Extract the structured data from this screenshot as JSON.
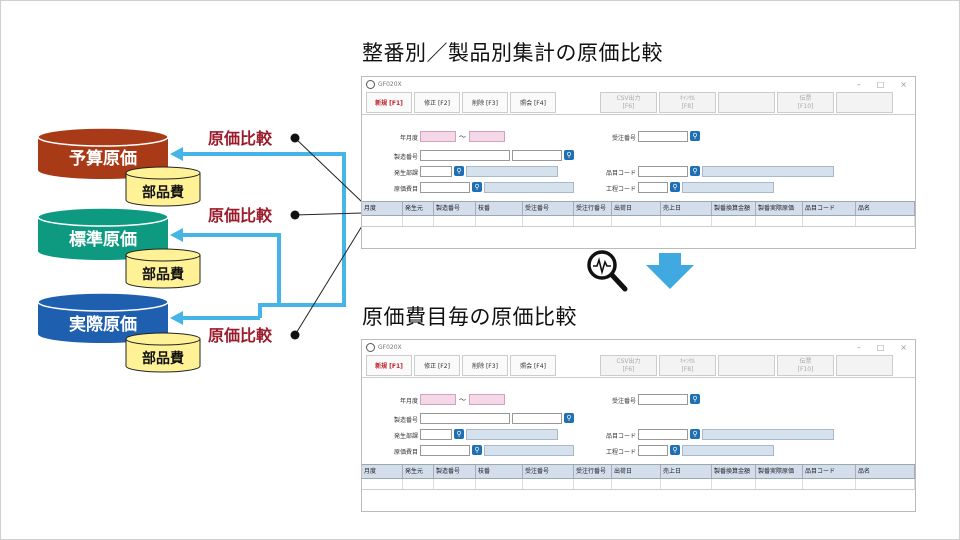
{
  "heading_top": "整番別／製品別集計の原価比較",
  "heading_bottom": "原価費目毎の原価比較",
  "cylinders": [
    {
      "label": "予算原価",
      "sub": "部品費",
      "color": "#a83a17"
    },
    {
      "label": "標準原価",
      "sub": "部品費",
      "color": "#0e9a80"
    },
    {
      "label": "実際原価",
      "sub": "部品費",
      "color": "#1f5faf"
    }
  ],
  "compare_labels": [
    "原価比較",
    "原価比較",
    "原価比較"
  ],
  "sub_color": "#fff296",
  "arrow_color": "#45b4e6",
  "down_arrow_color": "#3fa9e0",
  "icons": {
    "analyze": "magnifier-waveform-icon",
    "down": "down-arrow-icon"
  },
  "window": {
    "title": "GF020X",
    "buttons": [
      "新規 [F1]",
      "修正 [F2]",
      "削除 [F3]",
      "照会 [F4]"
    ],
    "disabled_buttons": [
      {
        "line1": "CSV出力",
        "line2": "[F6]"
      },
      {
        "line1": "ｷｬﾝｾﾙ",
        "line2": "[F8]"
      },
      {
        "line1": "",
        "line2": ""
      },
      {
        "line1": "伝票",
        "line2": "[F10]"
      },
      {
        "line1": "",
        "line2": ""
      }
    ],
    "fields_left": [
      "年月度",
      "製造番号",
      "発生部課",
      "原価費目"
    ],
    "fields_right": [
      "受注番号",
      "品目コード",
      "工程コード"
    ],
    "tilde": "～",
    "search_glyph": "⚲",
    "columns": [
      "月度",
      "発生元",
      "製造番号",
      "枝番",
      "受注番号",
      "受注行番号",
      "出荷日",
      "売上日",
      "製番換算金額",
      "製番実際原価",
      "品目コード",
      "品名"
    ]
  }
}
